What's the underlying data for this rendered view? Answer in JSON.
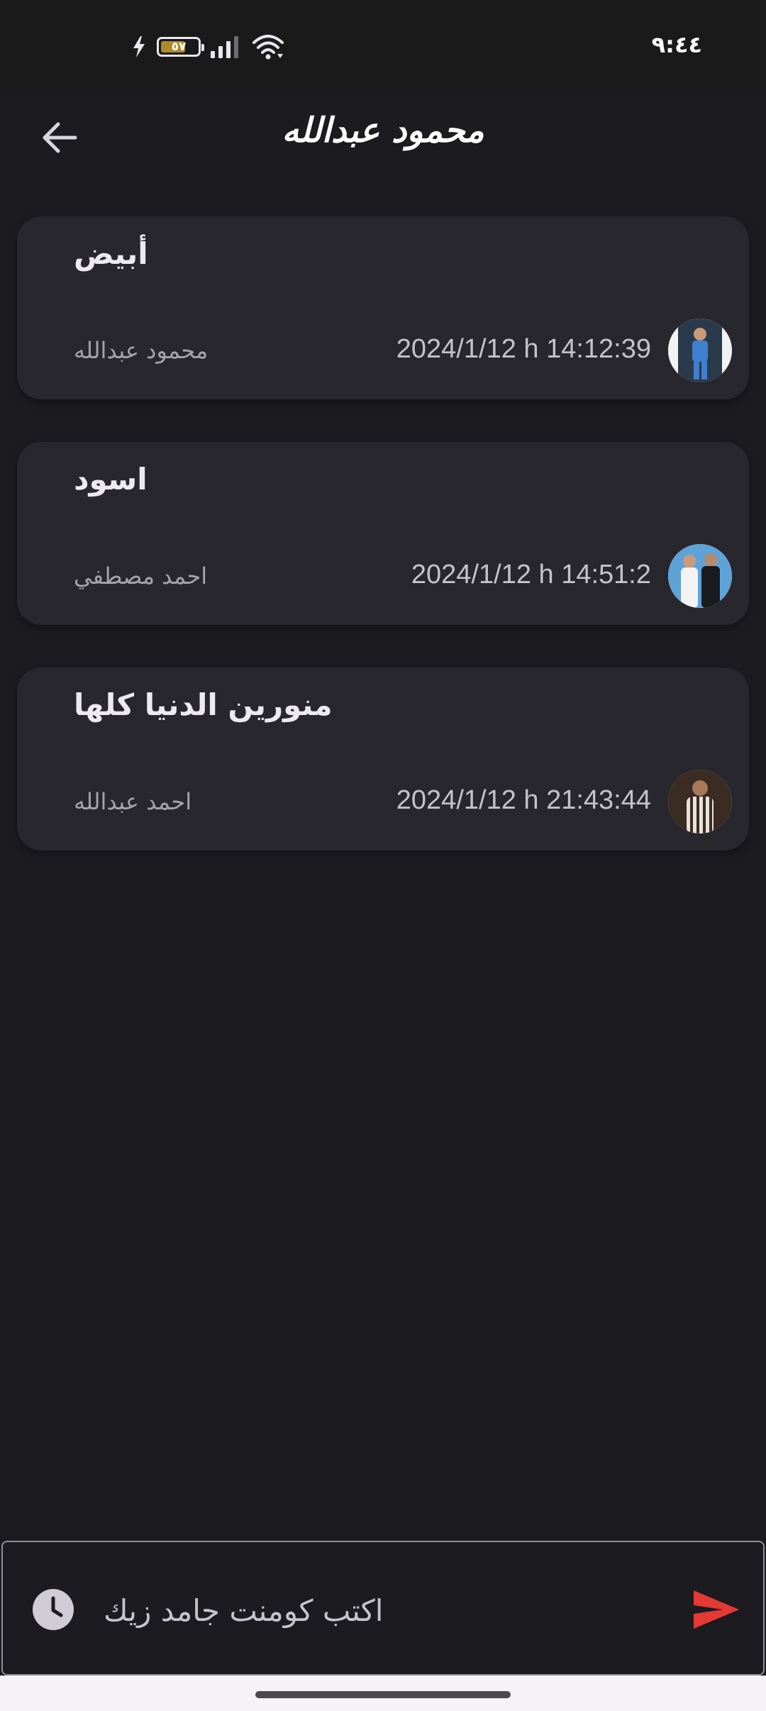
{
  "status_bar": {
    "time": "٩:٤٤",
    "battery_level": "٥٧",
    "colors": {
      "battery_fill": "#b08a2a"
    }
  },
  "app_bar": {
    "title": "محمود عبدالله",
    "back_icon": "arrow-left-icon"
  },
  "comments": [
    {
      "text": "أبيض",
      "author": "محمود عبدالله",
      "time": "2024/1/12 h 14:12:39",
      "avatar_icon": "avatar-person-blue-suit"
    },
    {
      "text": "اسود",
      "author": "احمد مصطفي",
      "time": "2024/1/12 h 14:51:2",
      "avatar_icon": "avatar-two-people"
    },
    {
      "text": "منورين الدنيا كلها",
      "author": "احمد عبدالله",
      "time": "2024/1/12 h 21:43:44",
      "avatar_icon": "avatar-person-striped-shirt"
    }
  ],
  "input_bar": {
    "placeholder": "اكتب كومنت جامد زيك",
    "value": "",
    "clock_icon": "clock-icon",
    "send_icon": "send-icon",
    "colors": {
      "send": "#e53935"
    }
  },
  "colors": {
    "background": "#1c1b20",
    "card": "#28272d",
    "status_bar": "#1a1a1a"
  }
}
